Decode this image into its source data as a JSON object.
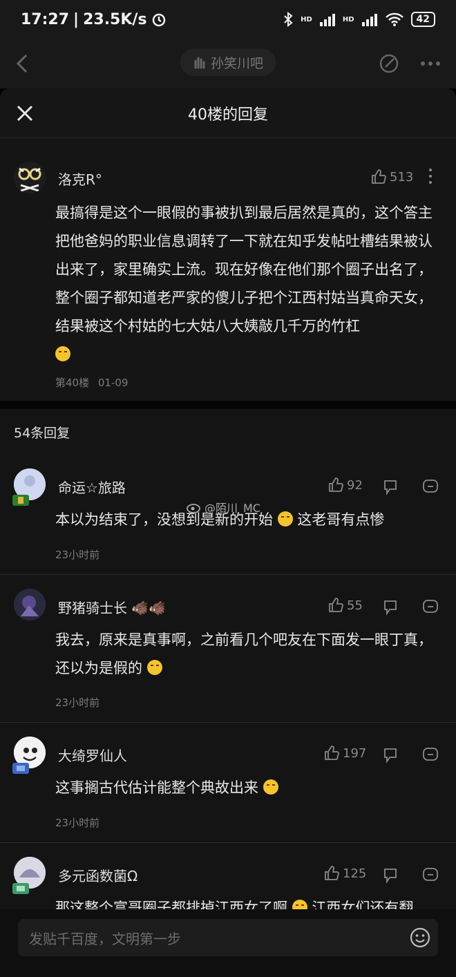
{
  "status_bar": {
    "time": "17:27",
    "speed": "23.5K/s",
    "battery": "42",
    "signal_label_1": "HD",
    "signal_label_2": "HD"
  },
  "page_header": {
    "forum_name": "孙笑川吧"
  },
  "sheet": {
    "title": "40楼的回复"
  },
  "main_post": {
    "username": "洛克R°",
    "likes": "513",
    "content": "最搞得是这个一眼假的事被扒到最后居然是真的，这个答主把他爸妈的职业信息调转了一下就在知乎发帖吐槽结果被认出来了，家里确实上流。现在好像在他们那个圈子出名了，整个圈子都知道老严家的傻儿子把个江西村姑当真命天女，结果被这个村姑的七大姑八大姨敲几千万的竹杠",
    "floor": "第40楼",
    "date": "01-09"
  },
  "replies_count_label": "54条回复",
  "watermark": "@陌川_MC",
  "replies": [
    {
      "username": "命运☆旅路",
      "likes": "92",
      "content_before": "本以为结束了，没想到是新的开始",
      "content_after": "这老哥有点惨",
      "time": "23小时前"
    },
    {
      "username": "野猪骑士长",
      "likes": "55",
      "content_before": "我去，原来是真事啊，之前看几个吧友在下面发一眼丁真，还以为是假的",
      "content_after": "",
      "time": "23小时前"
    },
    {
      "username": "大绮罗仙人",
      "likes": "197",
      "content_before": "这事搁古代估计能整个典故出来",
      "content_after": "",
      "time": "23小时前"
    },
    {
      "username": "多元函数菌Ω",
      "likes": "125",
      "content_before": "那这整个富哥圈子都排掉江西女了啊",
      "content_after": "江西女们还有翻",
      "time": ""
    }
  ],
  "bottom_bar": {
    "input_placeholder": "发贴千百度，文明第一步"
  }
}
